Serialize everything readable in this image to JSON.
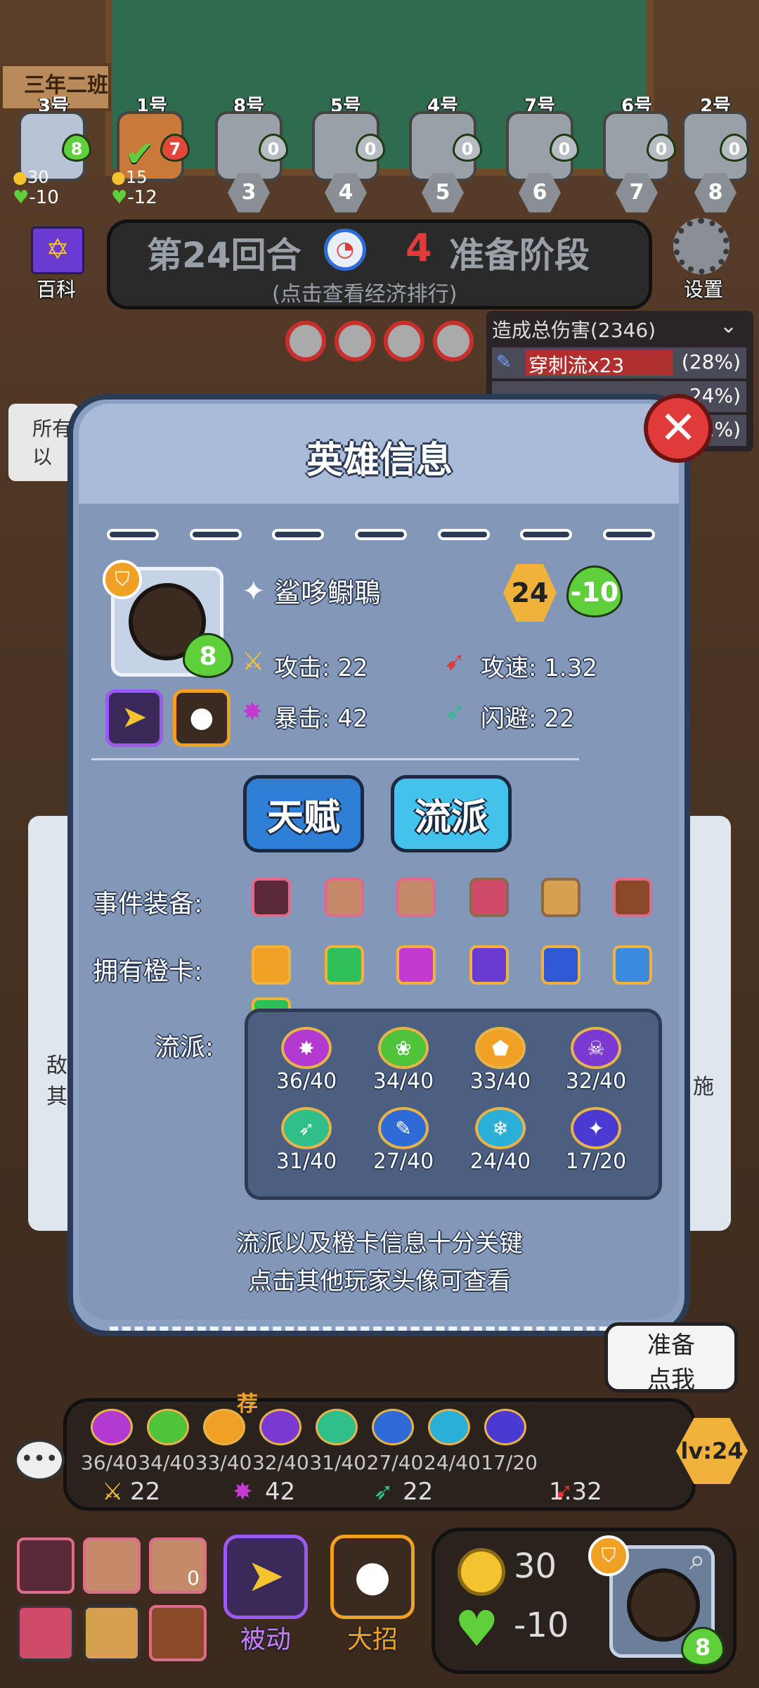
{
  "topbar": {
    "class_name": "三年二班",
    "players": [
      {
        "num": "3号",
        "hp": "8",
        "active": true
      },
      {
        "num": "1号",
        "hp": "7",
        "active": true
      },
      {
        "num": "8号",
        "hp": "0"
      },
      {
        "num": "5号",
        "hp": "0"
      },
      {
        "num": "4号",
        "hp": "0"
      },
      {
        "num": "7号",
        "hp": "0"
      },
      {
        "num": "6号",
        "hp": "0"
      },
      {
        "num": "2号",
        "hp": "0"
      }
    ],
    "p3_coins": "30",
    "p3_hp_change": "-10",
    "p1_coins": "15",
    "p1_hp_change": "-12",
    "ranks": [
      "3",
      "4",
      "5",
      "6",
      "7",
      "8"
    ]
  },
  "round": {
    "title": "第24回合",
    "timer": "4",
    "phase": "准备阶段",
    "hint": "(点击查看经济排行)",
    "encyclopedia": "百科",
    "settings": "设置"
  },
  "damage": {
    "title": "造成总伤害(2346)",
    "rows": [
      {
        "name": "穿刺流x23",
        "pct": "(28%)"
      },
      {
        "name": "",
        "pct": "24%)"
      },
      {
        "name": "",
        "pct": "1%)"
      }
    ]
  },
  "popup": {
    "title": "英雄信息",
    "hero_name": "鲨哆鳚鵈",
    "level": "24",
    "hp_change": "-10",
    "hero_hp": "8",
    "stats": {
      "attack": "攻击: 22",
      "attack_speed": "攻速: 1.32",
      "crit": "暴击: 42",
      "dodge": "闪避: 22"
    },
    "talent_btn": "天赋",
    "style_btn": "流派",
    "equip_label": "事件装备:",
    "cards_label": "拥有橙卡:",
    "styles_label": "流派:",
    "styles": [
      {
        "count": "36/40",
        "color": "#b33ad1",
        "icon": "✸"
      },
      {
        "count": "34/40",
        "color": "#4fc43a",
        "icon": "❀"
      },
      {
        "count": "33/40",
        "color": "#f0a024",
        "icon": "⬟"
      },
      {
        "count": "32/40",
        "color": "#7a3ad1",
        "icon": "☠"
      },
      {
        "count": "31/40",
        "color": "#2fbf8a",
        "icon": "➶"
      },
      {
        "count": "27/40",
        "color": "#2f6bd6",
        "icon": "✎"
      },
      {
        "count": "24/40",
        "color": "#2ab0d8",
        "icon": "❄"
      },
      {
        "count": "17/20",
        "color": "#4a3ad1",
        "icon": "✦"
      }
    ],
    "footer_line1": "流派以及橙卡信息十分关键",
    "footer_line2": "点击其他玩家头像可查看"
  },
  "side": {
    "left_text1": "所有",
    "left_text2": "以",
    "left_text3": "敌",
    "left_text4": "其",
    "right_text": "施"
  },
  "bottom": {
    "ready_hint1": "准备",
    "ready_hint2": "点我",
    "level": "lv:24",
    "recommend": "荐",
    "styles": [
      "36/40",
      "34/40",
      "33/40",
      "32/40",
      "31/40",
      "27/40",
      "24/40",
      "17/20"
    ],
    "attack": "22",
    "crit": "42",
    "dodge": "22",
    "attack_speed": "1.32",
    "item_count": "0",
    "passive_label": "被动",
    "ultimate_label": "大招",
    "coins": "30",
    "hp_change": "-10",
    "hero_hp": "8"
  },
  "colors": {
    "accent_red": "#e03a3a",
    "heart_green": "#5fcf3c",
    "panel_blue": "#8aa0c2",
    "gold": "#f0b23a"
  }
}
